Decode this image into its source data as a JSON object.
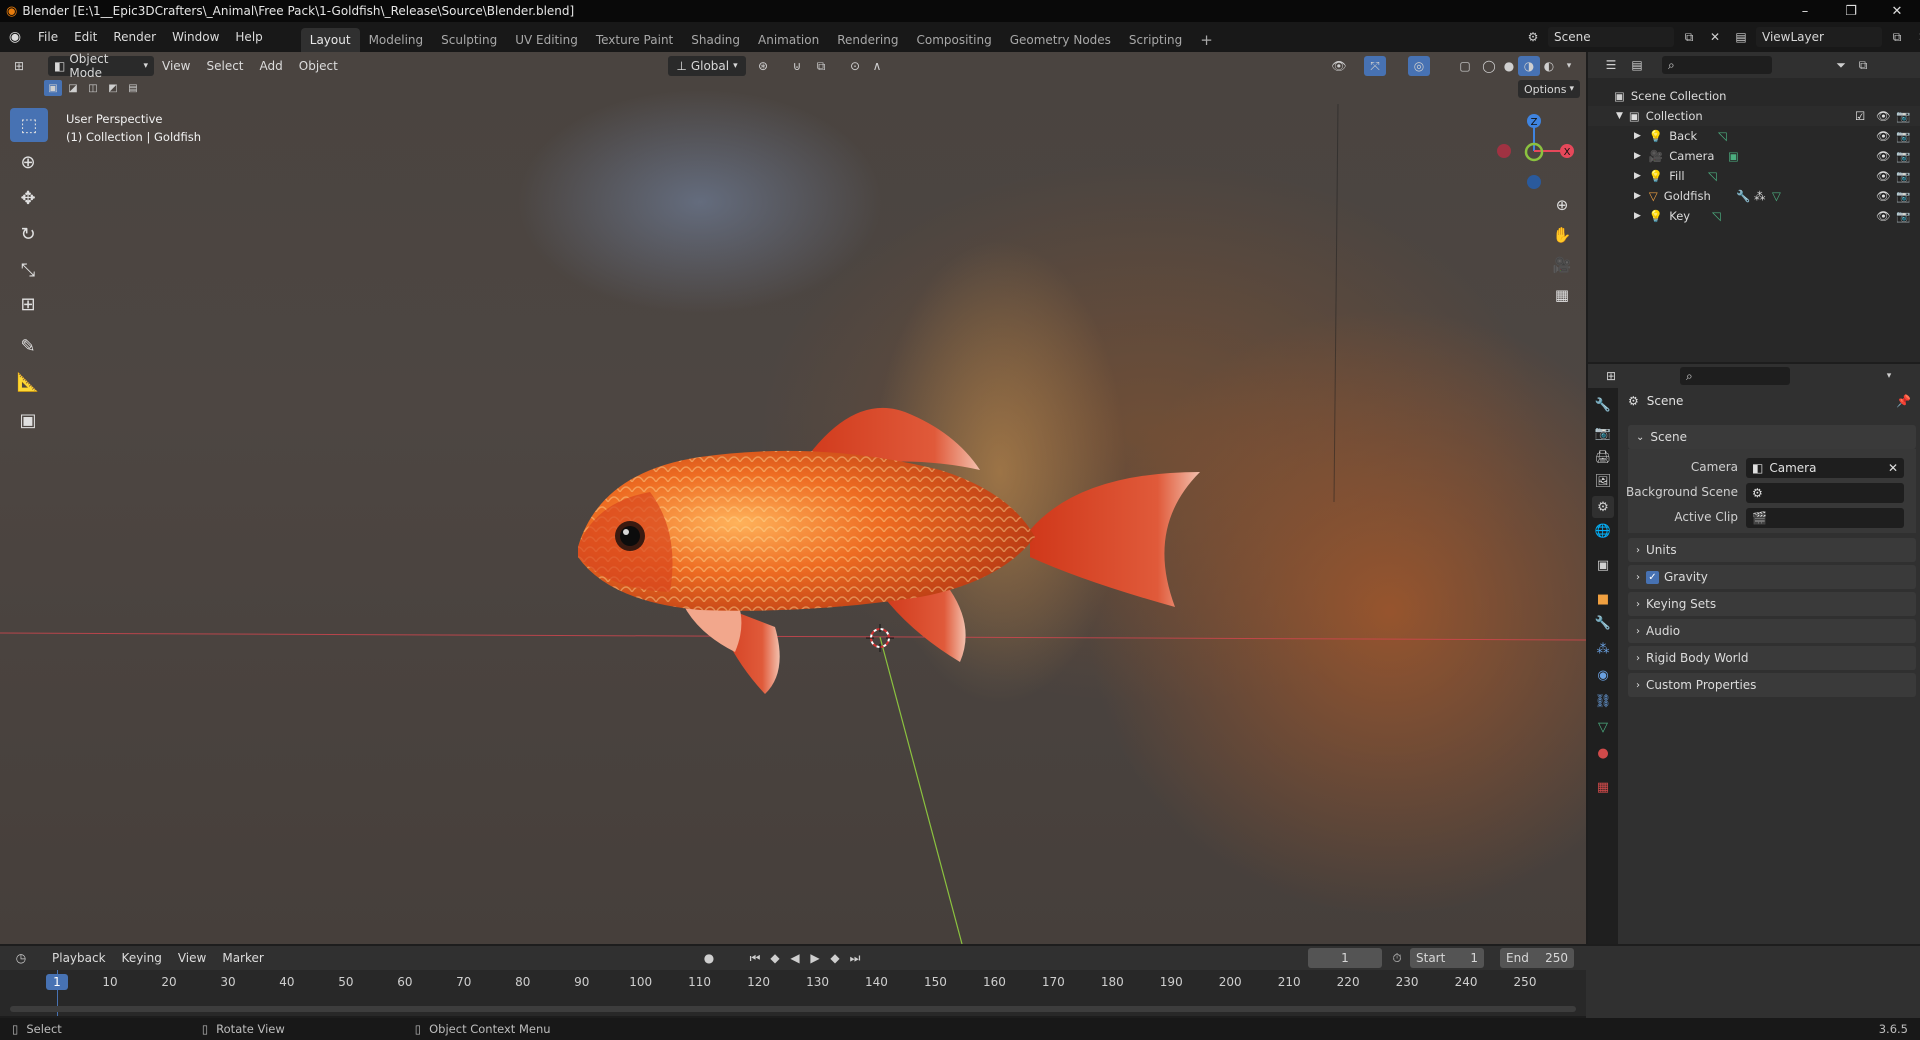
{
  "window": {
    "title": "Blender [E:\\1__Epic3DCrafters\\_Animal\\Free Pack\\1-Goldfish\\_Release\\Source\\Blender.blend]",
    "minimize": "–",
    "maximize": "❐",
    "close": "✕"
  },
  "menu": {
    "items": [
      "File",
      "Edit",
      "Render",
      "Window",
      "Help"
    ]
  },
  "workspaces": {
    "tabs": [
      "Layout",
      "Modeling",
      "Sculpting",
      "UV Editing",
      "Texture Paint",
      "Shading",
      "Animation",
      "Rendering",
      "Compositing",
      "Geometry Nodes",
      "Scripting"
    ],
    "active": "Layout",
    "add": "+"
  },
  "scene": {
    "name": "Scene",
    "viewlayer": "ViewLayer"
  },
  "viewport": {
    "mode": "Object Mode",
    "menus": [
      "View",
      "Select",
      "Add",
      "Object"
    ],
    "orientation": "Global",
    "options": "Options",
    "info_line1": "User Perspective",
    "info_line2": "(1) Collection | Goldfish",
    "gizmo": {
      "z": "Z",
      "y": "Y",
      "x": "X"
    }
  },
  "outliner": {
    "root": "Scene Collection",
    "collection": "Collection",
    "items": [
      {
        "name": "Back",
        "icon": "light-icon"
      },
      {
        "name": "Camera",
        "icon": "camera-icon"
      },
      {
        "name": "Fill",
        "icon": "light-icon"
      },
      {
        "name": "Goldfish",
        "icon": "mesh-icon"
      },
      {
        "name": "Key",
        "icon": "light-icon"
      }
    ]
  },
  "properties": {
    "header": "Scene",
    "section": "Scene",
    "camera_label": "Camera",
    "camera_value": "Camera",
    "bg_scene_label": "Background Scene",
    "bg_scene_value": "",
    "active_clip_label": "Active Clip",
    "active_clip_value": "",
    "panels": [
      "Units",
      "Gravity",
      "Keying Sets",
      "Audio",
      "Rigid Body World",
      "Custom Properties"
    ],
    "gravity_checked": true
  },
  "timeline": {
    "menus": [
      "Playback",
      "Keying",
      "View",
      "Marker"
    ],
    "current_frame": "1",
    "start_label": "Start",
    "start": "1",
    "end_label": "End",
    "end": "250",
    "ticks": [
      "1",
      "10",
      "20",
      "30",
      "40",
      "50",
      "60",
      "70",
      "80",
      "90",
      "100",
      "110",
      "120",
      "130",
      "140",
      "150",
      "160",
      "170",
      "180",
      "190",
      "200",
      "210",
      "220",
      "230",
      "240",
      "250"
    ]
  },
  "status": {
    "select": "Select",
    "rotate": "Rotate View",
    "context": "Object Context Menu",
    "version": "3.6.5"
  },
  "colors": {
    "accent": "#4772b3",
    "xaxis": "#e6485a",
    "yaxis": "#8bc23f",
    "zaxis": "#3f84e0"
  }
}
